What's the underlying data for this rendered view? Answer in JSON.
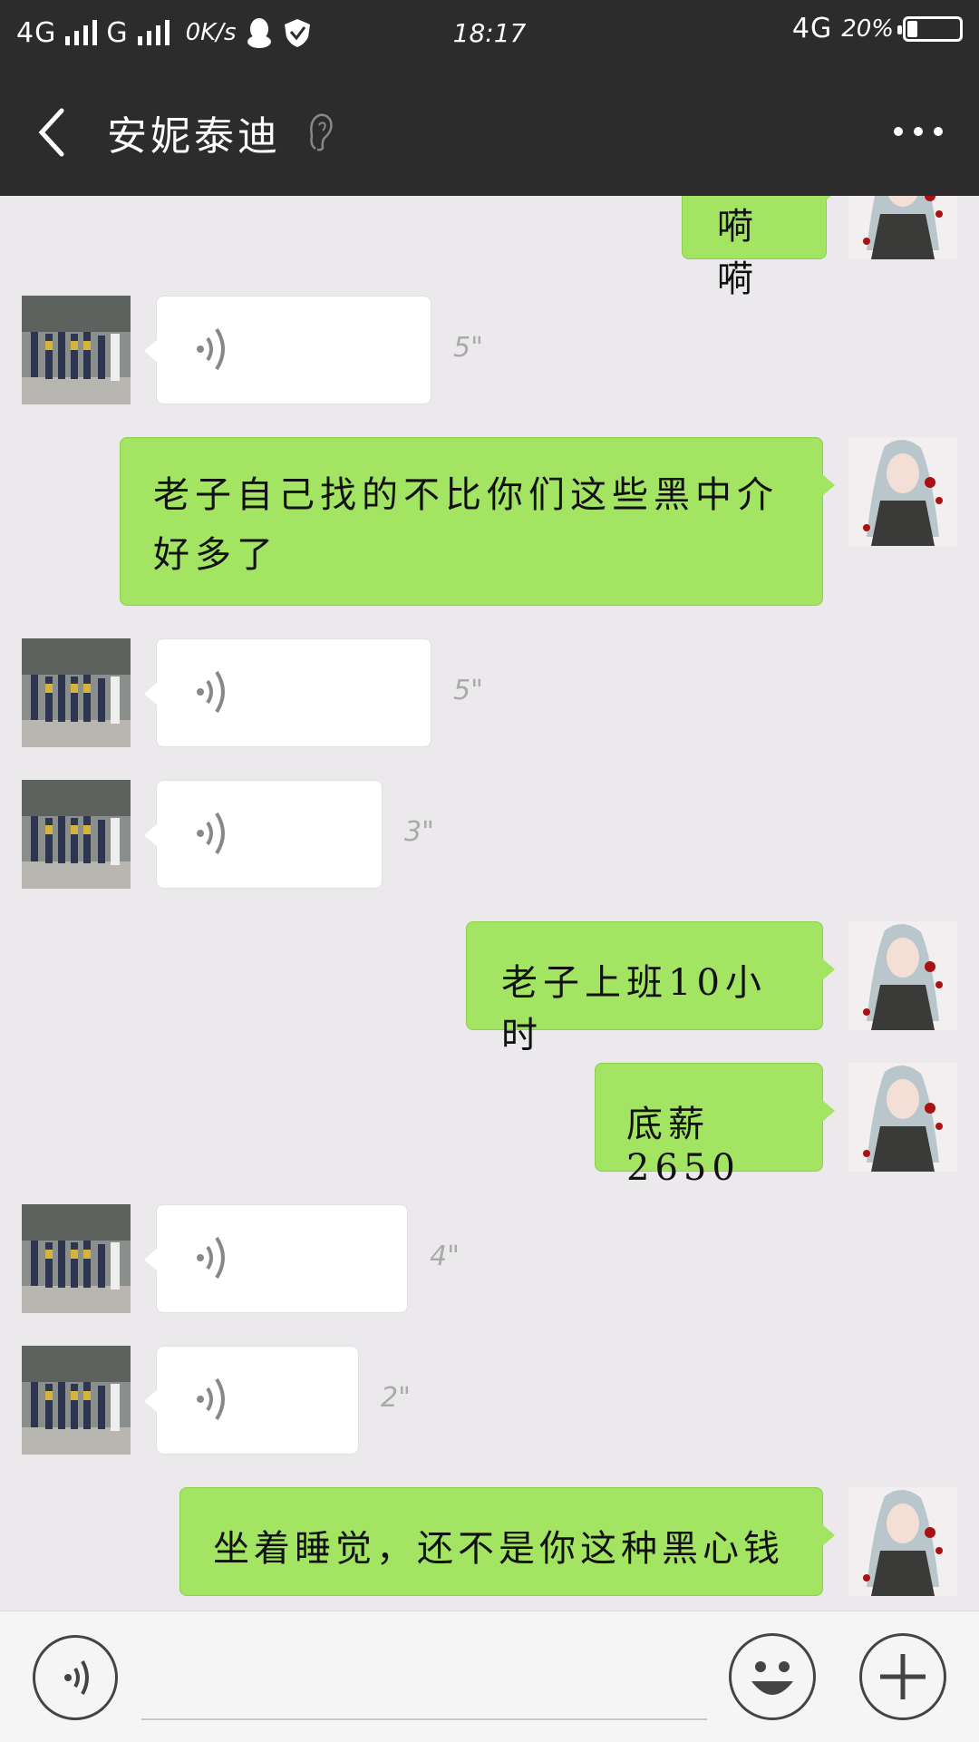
{
  "status_bar": {
    "network_1": "4G",
    "network_2": "G",
    "speed": "0K/s",
    "time": "18:17",
    "network_right": "4G",
    "battery": "20%",
    "battery_level": 0.2
  },
  "header": {
    "contact_name": "安妮泰迪",
    "back_icon": "chevron-left-icon",
    "ear_icon": "ear-icon",
    "more_icon": "more-icon"
  },
  "messages": [
    {
      "side": "right",
      "type": "text",
      "text": "嗬嗬"
    },
    {
      "side": "left",
      "type": "voice",
      "duration": "5\""
    },
    {
      "side": "right",
      "type": "text",
      "text": "老子自己找的不比你们这些黑中介好多了"
    },
    {
      "side": "left",
      "type": "voice",
      "duration": "5\""
    },
    {
      "side": "left",
      "type": "voice",
      "duration": "3\""
    },
    {
      "side": "right",
      "type": "text",
      "text": "老子上班10小时"
    },
    {
      "side": "right",
      "type": "text",
      "text": "底薪2650"
    },
    {
      "side": "left",
      "type": "voice",
      "duration": "4\""
    },
    {
      "side": "left",
      "type": "voice",
      "duration": "2\""
    },
    {
      "side": "right",
      "type": "text",
      "text": "坐着睡觉，还不是你这种黑心钱"
    }
  ],
  "colors": {
    "bar": "#2c2c2c",
    "chat_bg": "#ebe9ec",
    "sent_bubble": "#a3e462",
    "received_bubble": "#ffffff"
  },
  "input_bar": {
    "voice_icon": "voice-mode-icon",
    "emoji_icon": "emoji-icon",
    "plus_icon": "plus-icon"
  }
}
